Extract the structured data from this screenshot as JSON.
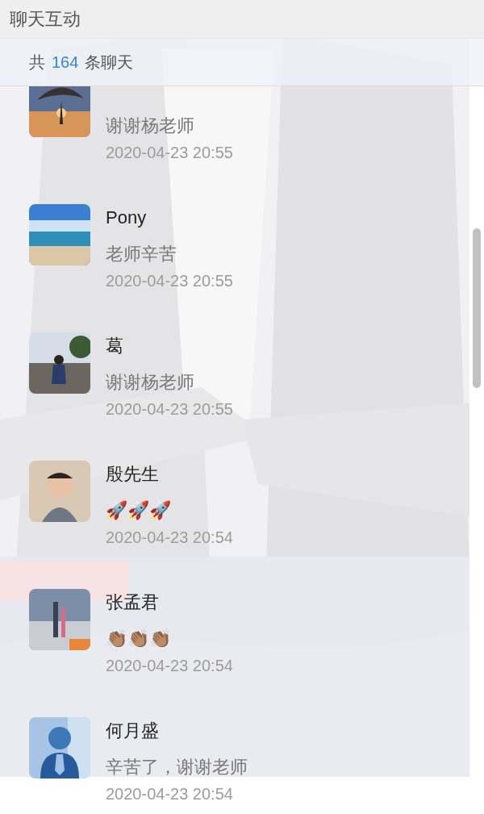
{
  "header": {
    "title": "聊天互动"
  },
  "summary": {
    "prefix": "共",
    "count": "164",
    "suffix": "条聊天"
  },
  "messages": [
    {
      "message": "谢谢杨老师",
      "time": "2020-04-23 20:55"
    },
    {
      "name": "Pony",
      "message": "老师辛苦",
      "time": "2020-04-23 20:55"
    },
    {
      "name": "葛",
      "message": "谢谢杨老师",
      "time": "2020-04-23 20:55"
    },
    {
      "name": "殷先生",
      "message": "🚀🚀🚀",
      "time": "2020-04-23 20:54"
    },
    {
      "name": "张孟君",
      "message": "👏🏽👏🏽👏🏽",
      "time": "2020-04-23 20:54"
    },
    {
      "name": "何月盛",
      "message": "辛苦了，谢谢老师",
      "time": "2020-04-23 20:54"
    }
  ]
}
